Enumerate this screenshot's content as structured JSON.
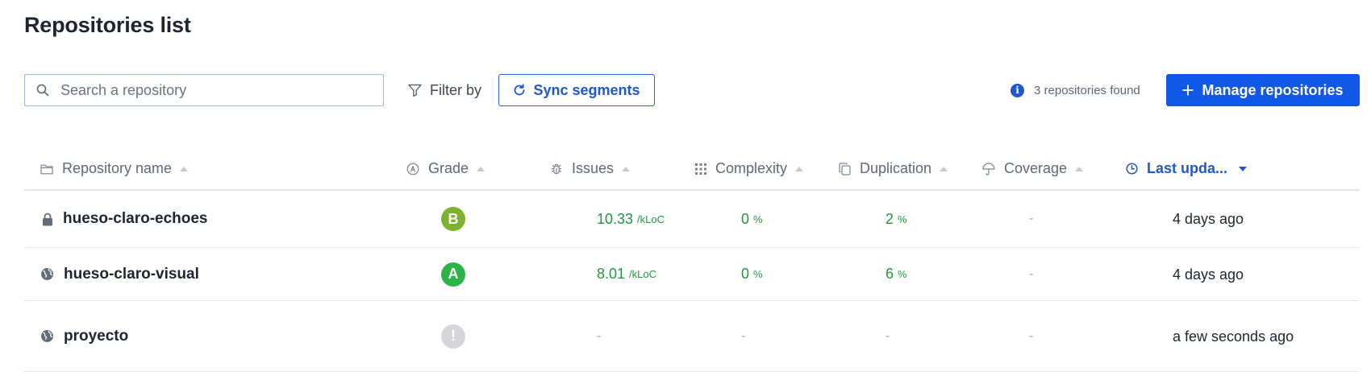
{
  "page": {
    "title": "Repositories list"
  },
  "toolbar": {
    "search_placeholder": "Search a repository",
    "filter_label": "Filter by",
    "sync_label": "Sync segments",
    "found_text": "3 repositories found",
    "manage_label": "Manage repositories"
  },
  "table": {
    "columns": [
      {
        "label": "Repository name",
        "icon": "folder-icon"
      },
      {
        "label": "Grade",
        "icon": "grade-icon"
      },
      {
        "label": "Issues",
        "icon": "bug-icon"
      },
      {
        "label": "Complexity",
        "icon": "grid-dots-icon"
      },
      {
        "label": "Duplication",
        "icon": "copy-icon"
      },
      {
        "label": "Coverage",
        "icon": "umbrella-icon"
      },
      {
        "label": "Last upda...",
        "icon": "clock-icon",
        "sorted": "desc"
      }
    ],
    "rows": [
      {
        "name": "hueso-claro-echoes",
        "visibility": "lock-icon",
        "grade": "B",
        "grade_color": "#7cb22c",
        "issues": "10.33",
        "issues_unit": "/kLoC",
        "complexity": "0",
        "complexity_unit": "%",
        "duplication": "2",
        "duplication_unit": "%",
        "coverage": "-",
        "updated": "4 days ago"
      },
      {
        "name": "hueso-claro-visual",
        "visibility": "globe-icon",
        "grade": "A",
        "grade_color": "#2db34a",
        "issues": "8.01",
        "issues_unit": "/kLoC",
        "complexity": "0",
        "complexity_unit": "%",
        "duplication": "6",
        "duplication_unit": "%",
        "coverage": "-",
        "updated": "4 days ago"
      },
      {
        "name": "proyecto",
        "visibility": "globe-icon",
        "grade": "!",
        "grade_color": "#d4d6da",
        "issues": "-",
        "complexity": "-",
        "duplication": "-",
        "coverage": "-",
        "updated": "a few seconds ago"
      }
    ]
  },
  "colors": {
    "primary": "#1158e6",
    "good": "#1d9a3c"
  }
}
